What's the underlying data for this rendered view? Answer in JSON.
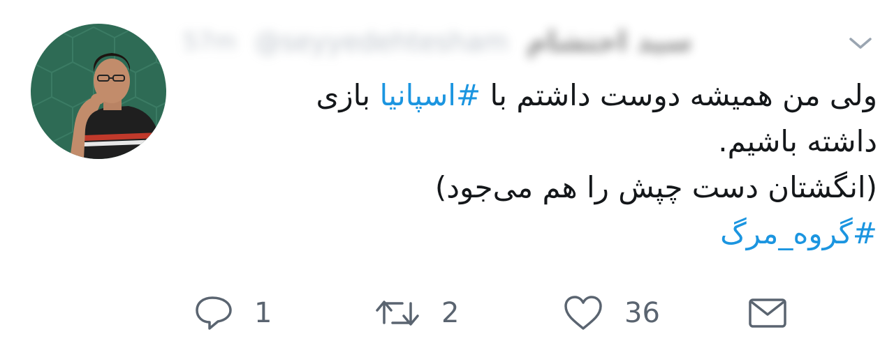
{
  "tweet": {
    "author_name": "سید احتشام",
    "author_handle": "@seyyedehtesham",
    "time": "57m",
    "lines": [
      {
        "parts": [
          {
            "text": "ولی من همیشه دوست داشتم با ",
            "tag": false
          },
          {
            "text": "#اسپانیا",
            "tag": true
          },
          {
            "text": " بازی",
            "tag": false
          }
        ]
      },
      {
        "parts": [
          {
            "text": "داشته باشیم.",
            "tag": false
          }
        ]
      },
      {
        "parts": [
          {
            "text": "(انگشتان دست چپش را هم می‌جود)",
            "tag": false
          }
        ]
      },
      {
        "parts": [
          {
            "text": "#گروه_مرگ",
            "tag": true
          }
        ]
      }
    ]
  },
  "actions": {
    "reply_count": "1",
    "retweet_count": "2",
    "like_count": "36"
  },
  "icons": {
    "reply": "speech-bubble-icon",
    "retweet": "retweet-arrows-icon",
    "like": "heart-icon",
    "dm": "envelope-icon",
    "menu": "chevron-down-icon"
  },
  "colors": {
    "hashtag": "#1b95e0",
    "text": "#14171a",
    "muted": "#5a6470"
  }
}
